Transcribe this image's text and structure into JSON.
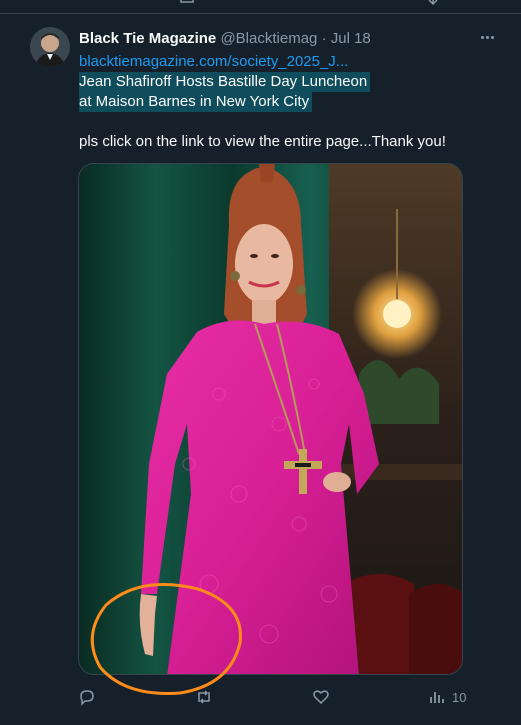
{
  "tweet": {
    "author_name": "Black Tie Magazine",
    "author_handle": "@Blacktiemag",
    "separator": "·",
    "date": "Jul 18",
    "link": "blacktiemagazine.com/society_2025_J...",
    "headline_line1": " Jean Shafiroff Hosts Bastille Day Luncheon ",
    "headline_line2": "at Maison Barnes in New York City",
    "body": "pls click on the link to view the entire page...Thank you!"
  },
  "actions": {
    "views_count": "10"
  },
  "icons": {
    "reply": "reply-icon",
    "retweet": "retweet-icon",
    "like": "like-icon",
    "views": "views-icon",
    "more": "more-icon"
  },
  "colors": {
    "background": "#15202b",
    "link": "#1d9bf0",
    "highlight": "#0f4c5c",
    "secondary_text": "#8b98a5",
    "annotation": "#ff8c1a"
  }
}
